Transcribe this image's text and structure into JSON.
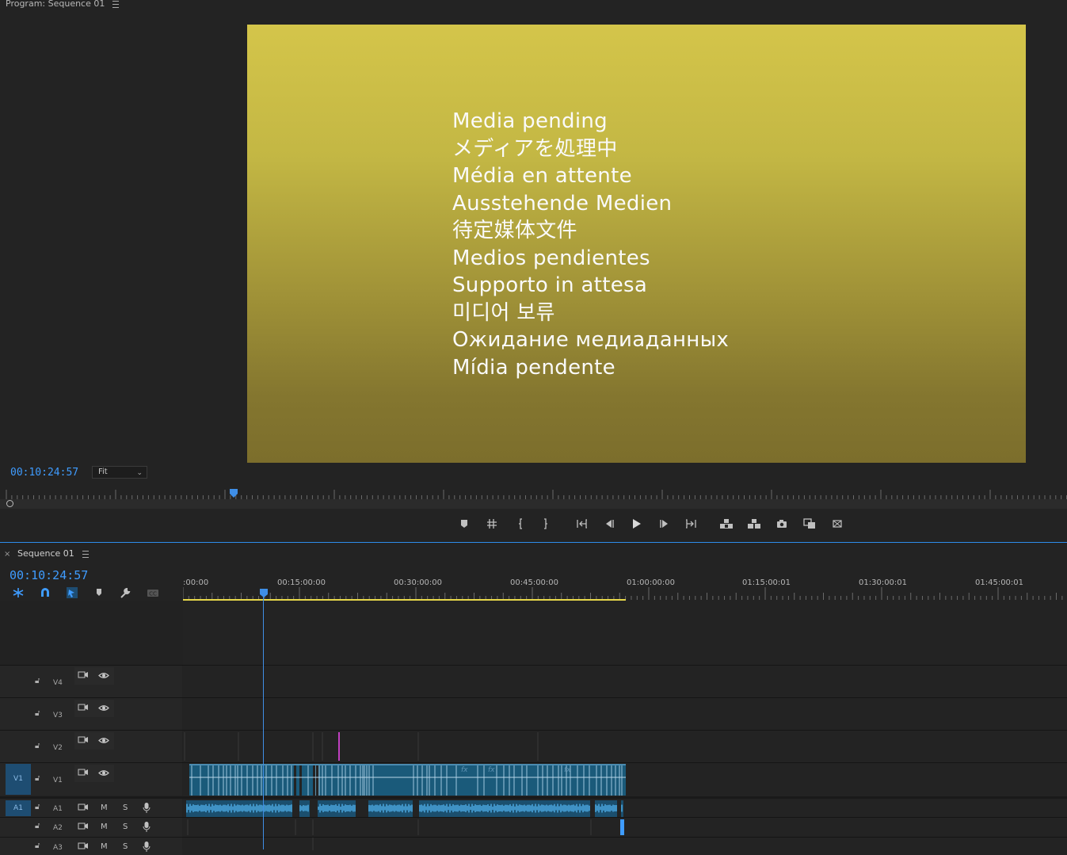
{
  "program": {
    "title": "Program: Sequence 01",
    "timecode": "00:10:24:57",
    "zoom_value": "Fit",
    "pending_lines": [
      "Media pending",
      "メディアを処理中",
      "Média en attente",
      "Ausstehende Medien",
      "待定媒体文件",
      "Medios pendientes",
      "Supporto in attesa",
      "미디어 보류",
      "Ожидание медиаданных",
      "Mídia pendente"
    ],
    "transport_icons": [
      "add-marker-icon",
      "mark-in-out-icon",
      "mark-in-icon",
      "mark-out-icon",
      "go-to-in-icon",
      "step-back-icon",
      "play-icon",
      "step-forward-icon",
      "go-to-out-icon",
      "lift-icon",
      "extract-icon",
      "export-frame-icon",
      "compare-view-icon",
      "vr-video-icon"
    ]
  },
  "timeline": {
    "tab_label": "Sequence 01",
    "close_glyph": "×",
    "timecode": "00:10:24:57",
    "ruler_labels": [
      ":00:00",
      "00:15:00:00",
      "00:30:00:00",
      "00:45:00:00",
      "01:00:00:00",
      "01:15:00:01",
      "01:30:00:01",
      "01:45:00:01"
    ],
    "tools": [
      "nest-icon",
      "snap-icon",
      "linked-selection-icon",
      "add-marker-icon",
      "settings-wrench-icon",
      "captions-icon"
    ],
    "video_tracks": [
      {
        "name": "V4",
        "target": ""
      },
      {
        "name": "V3",
        "target": ""
      },
      {
        "name": "V2",
        "target": ""
      },
      {
        "name": "V1",
        "target": "V1"
      }
    ],
    "audio_tracks": [
      {
        "name": "A1",
        "target": "A1",
        "mute": "M",
        "solo": "S"
      },
      {
        "name": "A2",
        "target": "",
        "mute": "M",
        "solo": "S"
      },
      {
        "name": "A3",
        "target": "",
        "mute": "M",
        "solo": "S"
      }
    ],
    "fx_badge": "fx",
    "colors": {
      "accent": "#3f9cff",
      "clip": "#1a5a7a",
      "work_area": "#e8d84a",
      "frame_top": "#d4c54a",
      "frame_bottom": "#7c6e2c"
    }
  }
}
